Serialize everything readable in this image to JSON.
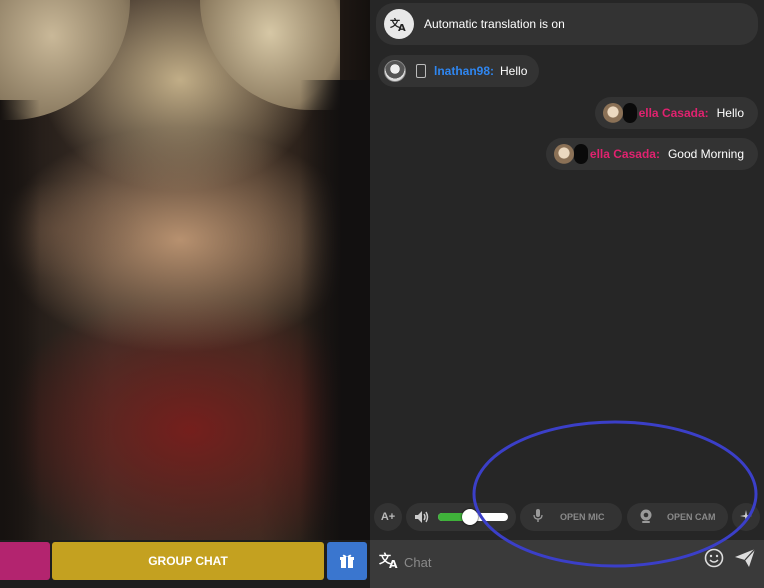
{
  "left_panel": {
    "group_chat_label": "GROUP CHAT"
  },
  "chat": {
    "translation_notice": "Automatic translation is on",
    "messages": [
      {
        "user": "lnathan98:",
        "text": "Hello",
        "user_color": "#2f86f0"
      },
      {
        "user": "ella Casada:",
        "text": "Hello",
        "user_color": "#e0226f"
      },
      {
        "user": "ella Casada:",
        "text": "Good Morning",
        "user_color": "#e0226f"
      }
    ]
  },
  "controls": {
    "font_label": "A+",
    "volume_level": 0.45,
    "open_mic_label": "OPEN MIC",
    "open_cam_label": "OPEN CAM"
  },
  "input": {
    "placeholder": "Chat"
  },
  "colors": {
    "pink_button": "#b3246f",
    "group_chat_button": "#c4a120",
    "gift_button": "#3a76cf",
    "annotation_ellipse": "#3b3fc8"
  },
  "icons": [
    "translate-icon",
    "phone-icon",
    "speaker-icon",
    "mic-icon",
    "webcam-icon",
    "effects-icon",
    "emoji-icon",
    "send-icon",
    "gift-icon"
  ]
}
